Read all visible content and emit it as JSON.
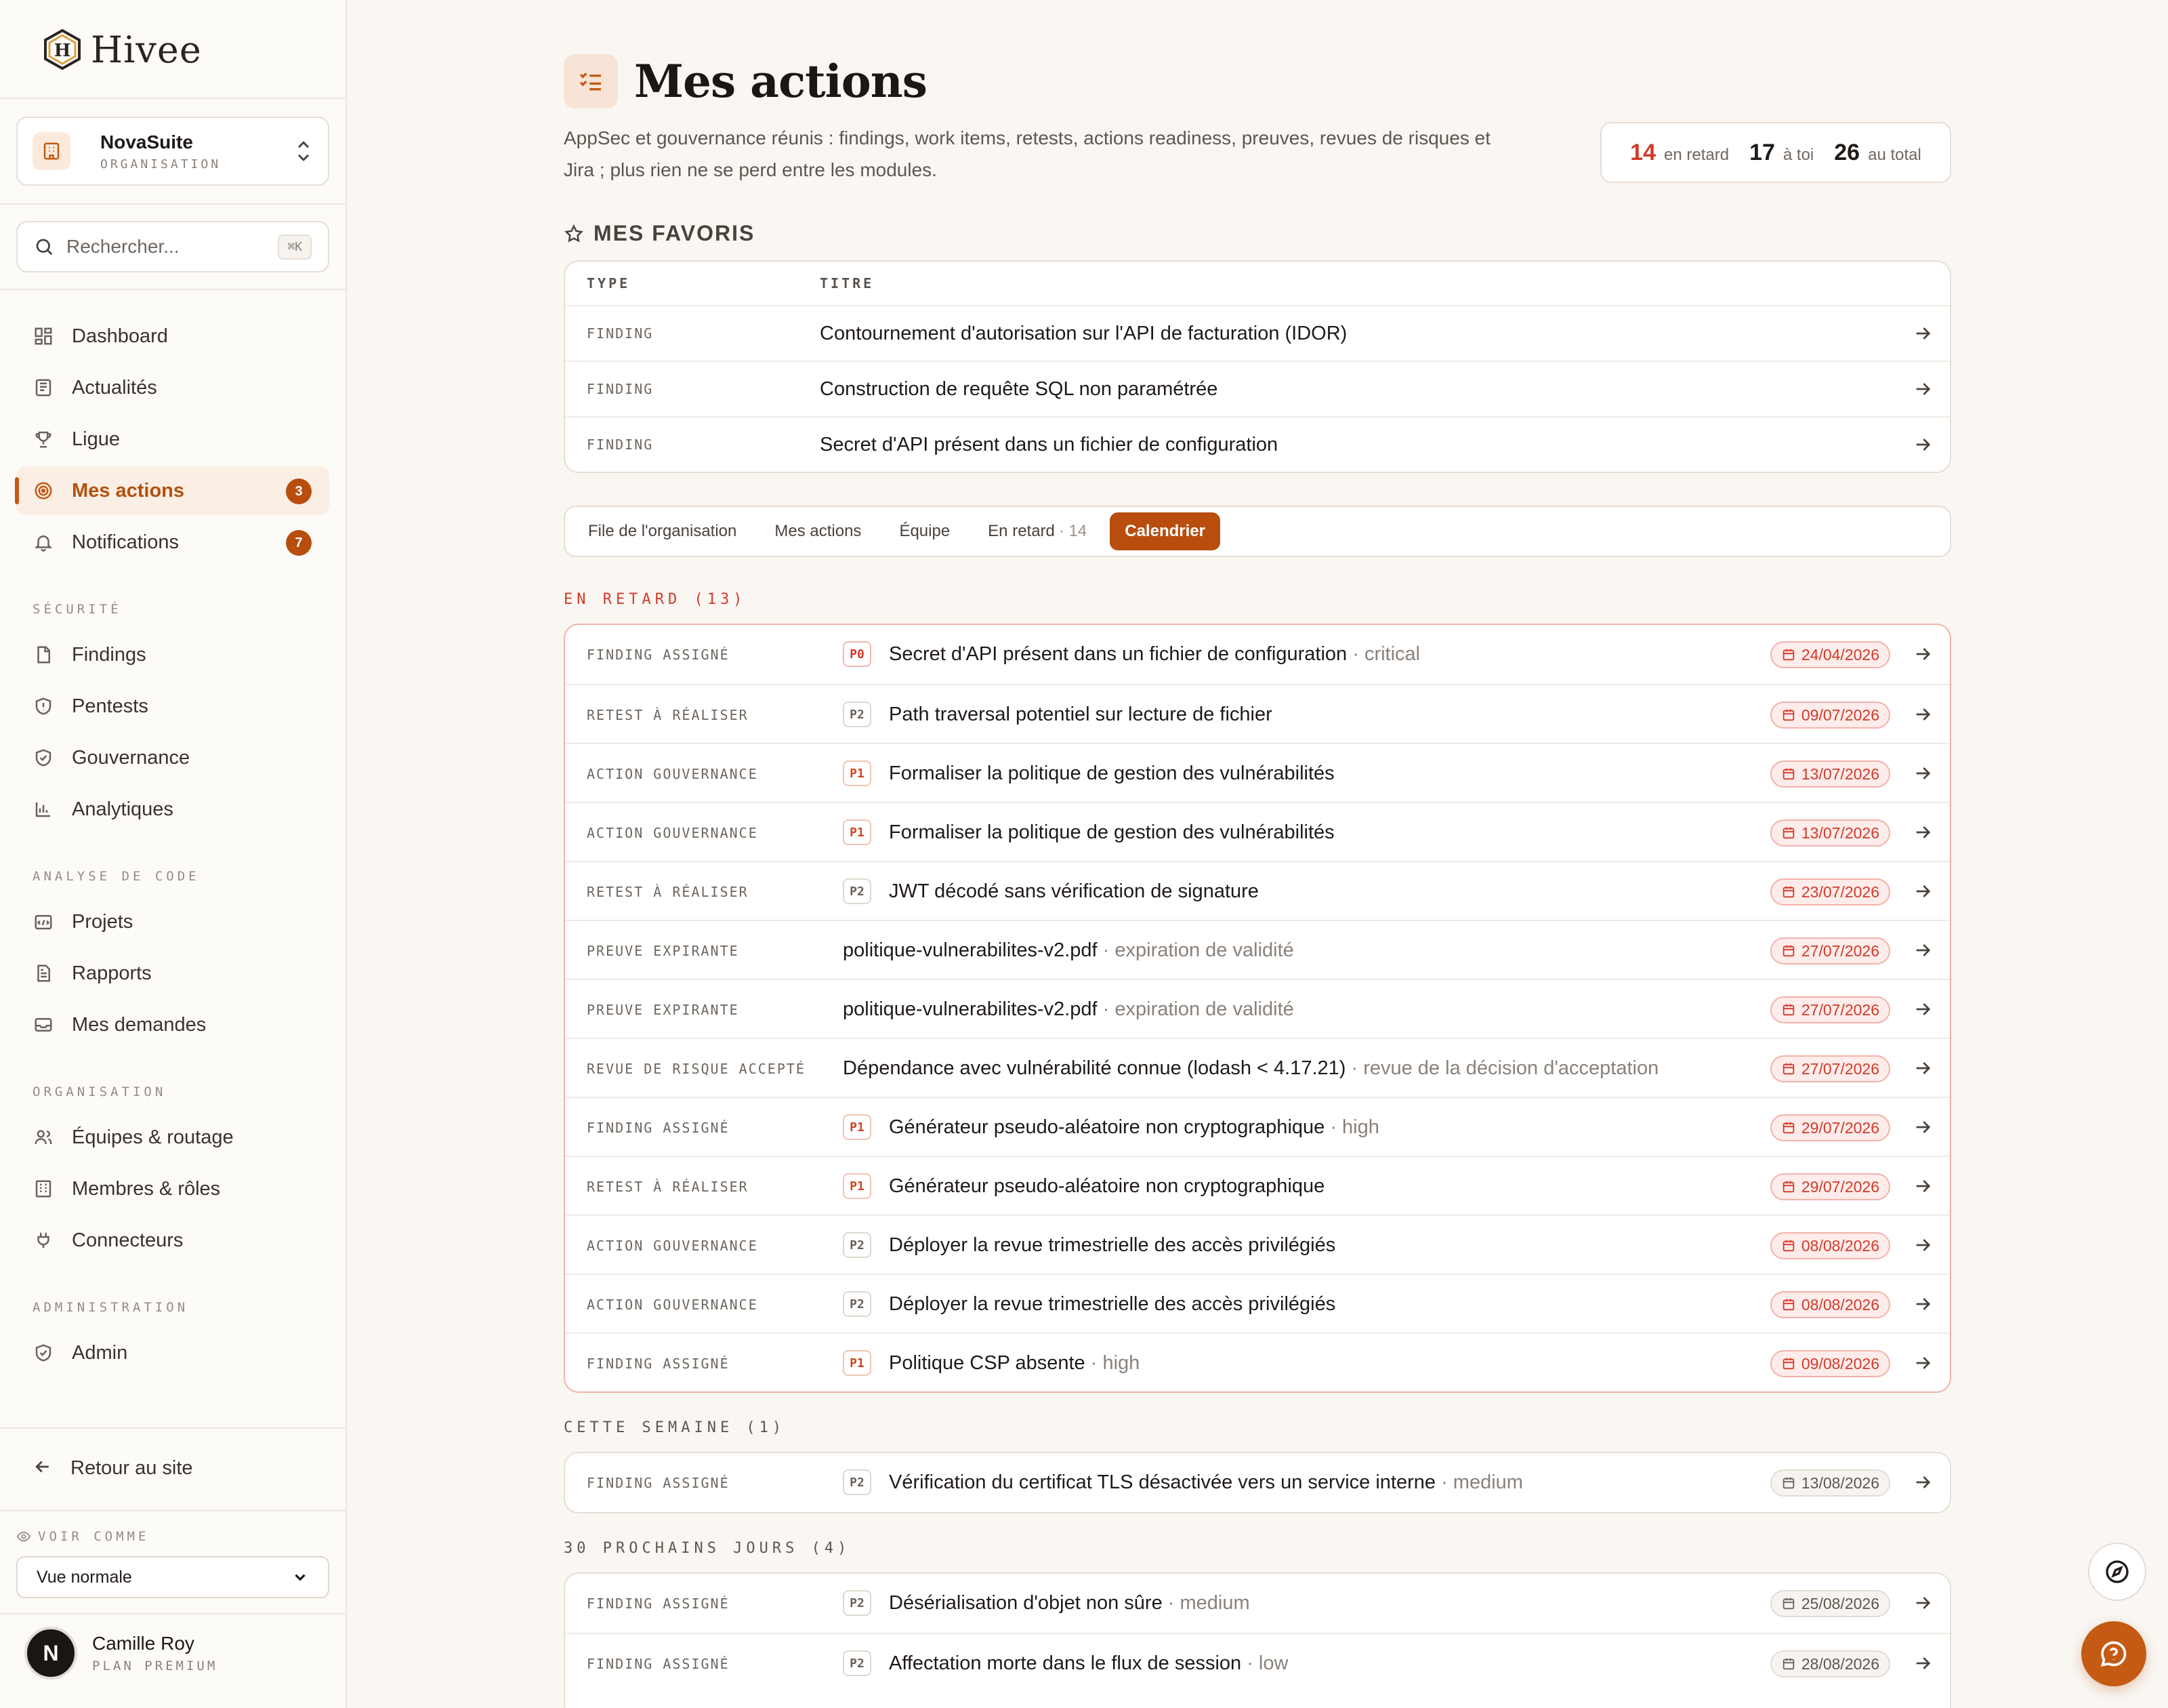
{
  "brand": {
    "name": "Hivee"
  },
  "org": {
    "name": "NovaSuite",
    "subtitle": "ORGANISATION"
  },
  "search": {
    "placeholder": "Rechercher...",
    "shortcut": "⌘K"
  },
  "nav": {
    "main": [
      {
        "label": "Dashboard",
        "icon": "dashboard-icon"
      },
      {
        "label": "Actualités",
        "icon": "newspaper-icon"
      },
      {
        "label": "Ligue",
        "icon": "trophy-icon"
      },
      {
        "label": "Mes actions",
        "icon": "target-icon",
        "badge": "3",
        "active": true
      },
      {
        "label": "Notifications",
        "icon": "bell-icon",
        "badge": "7"
      }
    ],
    "sections": [
      {
        "title": "SÉCURITÉ",
        "items": [
          {
            "label": "Findings",
            "icon": "file-icon"
          },
          {
            "label": "Pentests",
            "icon": "shield-alert-icon"
          },
          {
            "label": "Gouvernance",
            "icon": "shield-check-icon"
          },
          {
            "label": "Analytiques",
            "icon": "bar-chart-icon"
          }
        ]
      },
      {
        "title": "ANALYSE DE CODE",
        "items": [
          {
            "label": "Projets",
            "icon": "folder-code-icon"
          },
          {
            "label": "Rapports",
            "icon": "report-icon"
          },
          {
            "label": "Mes demandes",
            "icon": "inbox-icon"
          }
        ]
      },
      {
        "title": "ORGANISATION",
        "items": [
          {
            "label": "Équipes & routage",
            "icon": "users-icon"
          },
          {
            "label": "Membres & rôles",
            "icon": "building-icon"
          },
          {
            "label": "Connecteurs",
            "icon": "plug-icon"
          }
        ]
      },
      {
        "title": "ADMINISTRATION",
        "items": [
          {
            "label": "Admin",
            "icon": "shield-check-icon"
          }
        ]
      }
    ],
    "back": "Retour au site"
  },
  "view_as": {
    "title": "VOIR COMME",
    "value": "Vue normale"
  },
  "user": {
    "initial": "N",
    "name": "Camille Roy",
    "plan": "PLAN PREMIUM"
  },
  "page": {
    "title": "Mes actions",
    "description": "AppSec et gouvernance réunis : findings, work items, retests, actions readiness, preuves, revues de risques et Jira ; plus rien ne se perd entre les modules.",
    "stats": [
      {
        "num": "14",
        "label": "en retard"
      },
      {
        "num": "17",
        "label": "à toi"
      },
      {
        "num": "26",
        "label": "au total"
      }
    ]
  },
  "favorites": {
    "title": "MES FAVORIS",
    "columns": [
      "TYPE",
      "TITRE"
    ],
    "rows": [
      {
        "type": "FINDING",
        "title": "Contournement d'autorisation sur l'API de facturation (IDOR)"
      },
      {
        "type": "FINDING",
        "title": "Construction de requête SQL non paramétrée"
      },
      {
        "type": "FINDING",
        "title": "Secret d'API présent dans un fichier de configuration"
      }
    ]
  },
  "tabs": [
    {
      "label": "File de l'organisation"
    },
    {
      "label": "Mes actions"
    },
    {
      "label": "Équipe"
    },
    {
      "label": "En retard",
      "count": "· 14"
    },
    {
      "label": "Calendrier",
      "active": true
    }
  ],
  "groups": {
    "overdue": {
      "title": "EN RETARD (13)",
      "rows": [
        {
          "type": "FINDING ASSIGNÉ",
          "prio": "P0",
          "title": "Secret d'API présent dans un fichier de configuration",
          "extra": " · critical",
          "date": "24/04/2026"
        },
        {
          "type": "RETEST À RÉALISER",
          "prio": "P2",
          "title": "Path traversal potentiel sur lecture de fichier",
          "extra": "",
          "date": "09/07/2026"
        },
        {
          "type": "ACTION GOUVERNANCE",
          "prio": "P1",
          "title": "Formaliser la politique de gestion des vulnérabilités",
          "extra": "",
          "date": "13/07/2026"
        },
        {
          "type": "ACTION GOUVERNANCE",
          "prio": "P1",
          "title": "Formaliser la politique de gestion des vulnérabilités",
          "extra": "",
          "date": "13/07/2026"
        },
        {
          "type": "RETEST À RÉALISER",
          "prio": "P2",
          "title": "JWT décodé sans vérification de signature",
          "extra": "",
          "date": "23/07/2026"
        },
        {
          "type": "PREUVE EXPIRANTE",
          "prio": "",
          "title": "politique-vulnerabilites-v2.pdf",
          "extra": " · expiration de validité",
          "date": "27/07/2026"
        },
        {
          "type": "PREUVE EXPIRANTE",
          "prio": "",
          "title": "politique-vulnerabilites-v2.pdf",
          "extra": " · expiration de validité",
          "date": "27/07/2026"
        },
        {
          "type": "REVUE DE RISQUE ACCEPTÉ",
          "prio": "",
          "title": "Dépendance avec vulnérabilité connue (lodash < 4.17.21)",
          "extra": " · revue de la décision d'acceptation",
          "date": "27/07/2026"
        },
        {
          "type": "FINDING ASSIGNÉ",
          "prio": "P1",
          "title": "Générateur pseudo-aléatoire non cryptographique",
          "extra": " · high",
          "date": "29/07/2026"
        },
        {
          "type": "RETEST À RÉALISER",
          "prio": "P1",
          "title": "Générateur pseudo-aléatoire non cryptographique",
          "extra": "",
          "date": "29/07/2026"
        },
        {
          "type": "ACTION GOUVERNANCE",
          "prio": "P2",
          "title": "Déployer la revue trimestrielle des accès privilégiés",
          "extra": "",
          "date": "08/08/2026"
        },
        {
          "type": "ACTION GOUVERNANCE",
          "prio": "P2",
          "title": "Déployer la revue trimestrielle des accès privilégiés",
          "extra": "",
          "date": "08/08/2026"
        },
        {
          "type": "FINDING ASSIGNÉ",
          "prio": "P1",
          "title": "Politique CSP absente",
          "extra": " · high",
          "date": "09/08/2026"
        }
      ]
    },
    "week": {
      "title": "CETTE SEMAINE (1)",
      "rows": [
        {
          "type": "FINDING ASSIGNÉ",
          "prio": "P2",
          "title": "Vérification du certificat TLS désactivée vers un service interne",
          "extra": " · medium",
          "date": "13/08/2026"
        }
      ]
    },
    "next30": {
      "title": "30 PROCHAINS JOURS (4)",
      "rows": [
        {
          "type": "FINDING ASSIGNÉ",
          "prio": "P2",
          "title": "Désérialisation d'objet non sûre",
          "extra": " · medium",
          "date": "25/08/2026"
        },
        {
          "type": "FINDING ASSIGNÉ",
          "prio": "P2",
          "title": "Affectation morte dans le flux de session",
          "extra": " · low",
          "date": "28/08/2026"
        }
      ]
    }
  },
  "colors": {
    "accent": "#b84d0e",
    "danger": "#d23a2a",
    "background": "#faf7f3"
  }
}
